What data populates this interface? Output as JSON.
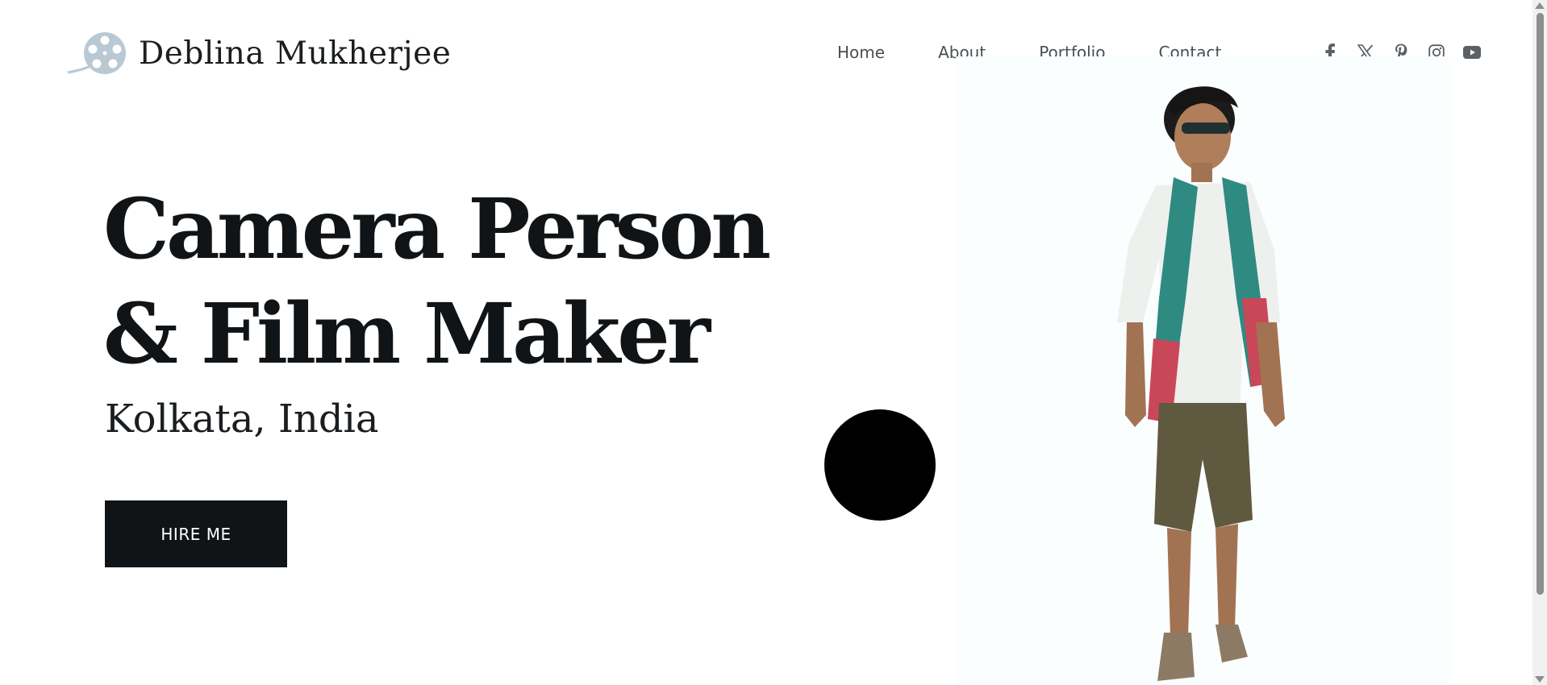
{
  "site": {
    "name": "Deblina Mukherjee",
    "logo_icon": "film-reel-icon"
  },
  "nav": {
    "items": [
      {
        "label": "Home"
      },
      {
        "label": "About"
      },
      {
        "label": "Portfolio"
      },
      {
        "label": "Contact"
      }
    ]
  },
  "social": {
    "icons": [
      "facebook-icon",
      "x-icon",
      "pinterest-icon",
      "instagram-icon",
      "youtube-icon"
    ]
  },
  "hero": {
    "title_line1": "Camera Person",
    "title_line2": "& Film Maker",
    "location": "Kolkata, India",
    "cta_label": "HIRE ME"
  },
  "colors": {
    "text": "#111416",
    "nav_text": "#4a4f53",
    "logo_icon": "#b9c9d3",
    "button_bg": "#111416",
    "button_text": "#ffffff",
    "photo_bg": "#fbfefe"
  }
}
